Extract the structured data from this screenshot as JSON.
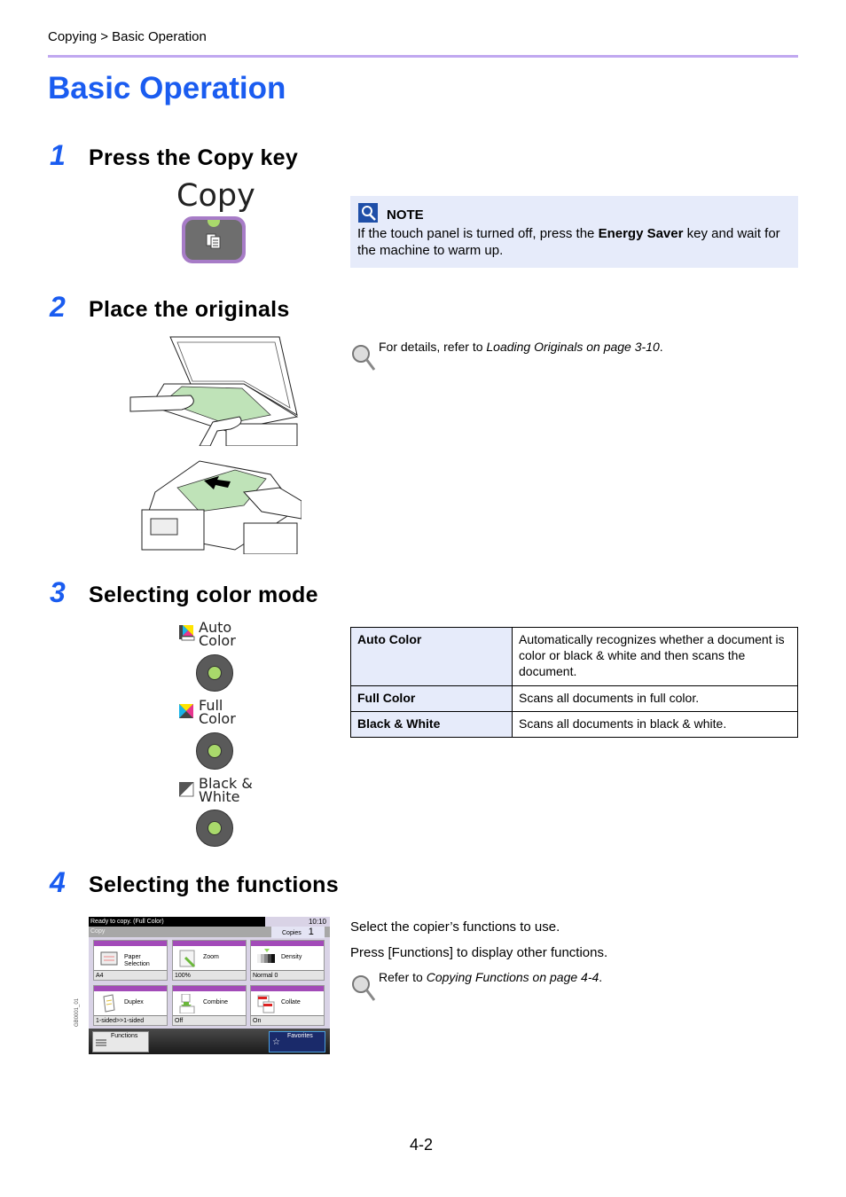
{
  "header": {
    "breadcrumb": "Copying > Basic Operation",
    "title": "Basic Operation"
  },
  "steps": [
    {
      "number": "1",
      "title": "Press the Copy key"
    },
    {
      "number": "2",
      "title": "Place the originals"
    },
    {
      "number": "3",
      "title": "Selecting color mode"
    },
    {
      "number": "4",
      "title": "Selecting the functions"
    }
  ],
  "copy_key": {
    "label": "Copy",
    "icon": "copy-document-icon",
    "led_color": "#a9d96b",
    "frame_color": "#a77cc7"
  },
  "note": {
    "label": "NOTE",
    "text_before": "If the touch panel is turned off, press the ",
    "text_bold": "Energy Saver",
    "text_after": " key and wait for the machine to warm up."
  },
  "originals_ref": {
    "prefix": "For details, refer to ",
    "link": "Loading Originals on page 3-10",
    "suffix": "."
  },
  "color_mode_keys": [
    {
      "line1": "Auto",
      "line2": "Color",
      "icon": "auto-color-icon"
    },
    {
      "line1": "Full",
      "line2": "Color",
      "icon": "full-color-icon"
    },
    {
      "line1": "Black &",
      "line2": "White",
      "icon": "black-white-icon"
    }
  ],
  "color_mode_table": [
    {
      "mode": "Auto Color",
      "description": "Automatically recognizes whether a document is color or black & white and then scans the document."
    },
    {
      "mode": "Full Color",
      "description": "Scans all documents in full color."
    },
    {
      "mode": "Black & White",
      "description": "Scans all documents in black & white."
    }
  ],
  "panel": {
    "status": "Ready to copy. (Full Color)",
    "time": "10:10",
    "mode": "Copy",
    "copies_label": "Copies",
    "copies_value": "1",
    "tiles": [
      {
        "label1": "Paper",
        "label2": "Selection",
        "value": "A4"
      },
      {
        "label1": "Zoom",
        "label2": "",
        "value": "100%"
      },
      {
        "label1": "Density",
        "label2": "",
        "value": "Normal 0"
      },
      {
        "label1": "Duplex",
        "label2": "",
        "value": "1-sided>>1-sided"
      },
      {
        "label1": "Combine",
        "label2": "",
        "value": "Off"
      },
      {
        "label1": "Collate",
        "label2": "",
        "value": "On"
      }
    ],
    "functions_label": "Functions",
    "favorites_label": "Favorites",
    "figure_code": "GB0001_01"
  },
  "functions_text": {
    "line1": "Select the copier’s functions to use.",
    "line2": "Press [Functions] to display other functions.",
    "ref_prefix": "Refer to ",
    "ref_link": "Copying Functions on page 4-4",
    "ref_suffix": "."
  },
  "footer": {
    "page_number": "4-2"
  }
}
